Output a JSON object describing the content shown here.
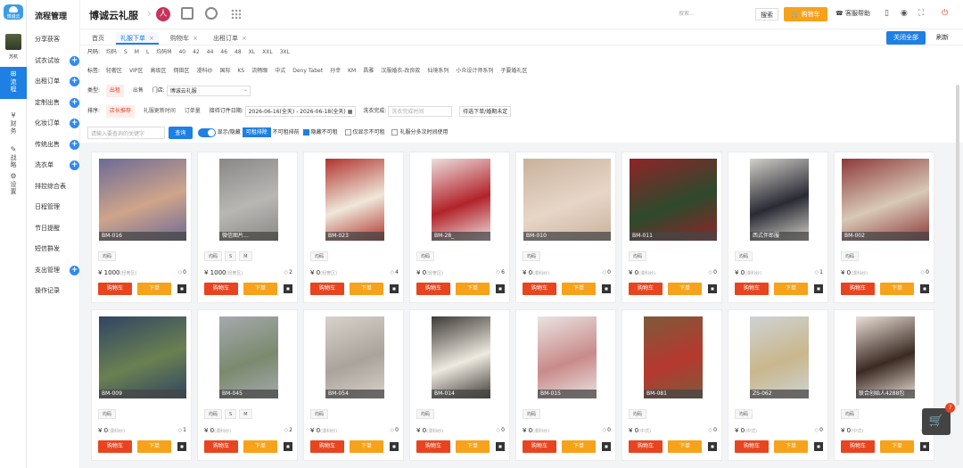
{
  "rail": {
    "logo": "博诚云",
    "user": "苏杭",
    "items": [
      {
        "icon": "⊞",
        "label": "流程",
        "active": true
      },
      {
        "icon": "¥",
        "label": "财务"
      },
      {
        "icon": "✎",
        "label": "战略"
      },
      {
        "icon": "⚙",
        "label": "设置"
      }
    ]
  },
  "submenu": {
    "title": "流程管理",
    "items": [
      {
        "label": "分享获客",
        "plus": false
      },
      {
        "label": "试衣试妆",
        "plus": true
      },
      {
        "label": "出租订单",
        "plus": true
      },
      {
        "label": "定制出售",
        "plus": true
      },
      {
        "label": "化妆订单",
        "plus": true
      },
      {
        "label": "传统出售",
        "plus": true
      },
      {
        "label": "洗衣单",
        "plus": true
      },
      {
        "label": "排控综合表",
        "plus": false
      },
      {
        "label": "日程管理",
        "plus": false
      },
      {
        "label": "节日提醒",
        "plus": false
      },
      {
        "label": "短信群发",
        "plus": false
      },
      {
        "label": "支出管理",
        "plus": true
      },
      {
        "label": "操作记录",
        "plus": false
      }
    ]
  },
  "header": {
    "brand": "博诚云礼服",
    "search_placeholder": "搜索...",
    "search_btn": "搜索",
    "cart_btn": "购物车",
    "help": "客服帮助"
  },
  "tabs": {
    "items": [
      {
        "label": "首页",
        "closable": false,
        "active": false
      },
      {
        "label": "礼服下单",
        "closable": true,
        "active": true
      },
      {
        "label": "购物车",
        "closable": true,
        "active": false
      },
      {
        "label": "出租订单",
        "closable": true,
        "active": false
      }
    ],
    "close_all": "关闭全部",
    "refresh": "刷新"
  },
  "filters": {
    "size": {
      "label": "尺码:",
      "options": [
        "均码",
        "S",
        "M",
        "L",
        "均码M",
        "40",
        "42",
        "44",
        "46",
        "48",
        "XL",
        "XXL",
        "3XL"
      ]
    },
    "tag": {
      "label": "标签:",
      "options": [
        "轻奢区",
        "VIP区",
        "高级区",
        "佣田区",
        "漫科纱",
        "国际",
        "KS",
        "流畅眼",
        "中式",
        "Deny Tabet",
        "孙幸",
        "KM",
        "昌雅",
        "汉服婚衣-改良款",
        "仙境系列",
        "小众设计师系列",
        "子要婚礼区"
      ]
    },
    "type": {
      "label": "类型:",
      "options": [
        "出租",
        "出售"
      ],
      "store_label": "门店:",
      "store_value": "博诚云礼服"
    },
    "sort": {
      "label": "排序:",
      "options": [
        "店长推荐",
        "礼服更新时间",
        "订单量"
      ],
      "date_label": "接待订件日期:",
      "date_value": "2026-06-16(全天) - 2026-06-18(全天)",
      "wash_label": "洗衣完成:",
      "wash_placeholder": "洗衣完成时间",
      "pending": "待选下单/婚期未定"
    },
    "keyword_placeholder": "请输入要查询的关键字",
    "query_btn": "查询",
    "show_hide": "显示/隐藏",
    "available": "可租排除",
    "unavailable": "不可租排前",
    "hide_unavailable": "隐藏不可租",
    "only_unavailable": "仅显示不可租",
    "multi_time": "礼服分多次时间使用"
  },
  "products": [
    {
      "code": "BM-016",
      "sizes": [
        "均码"
      ],
      "price": "¥ 1000",
      "note": "(轻奢区)",
      "count": "0",
      "bg": "#6d6a96",
      "accent": "#cfa58a"
    },
    {
      "code": "微信图片...",
      "sizes": [
        "均码",
        "S",
        "M"
      ],
      "price": "¥ 1000",
      "note": "(轻奢区)",
      "count": "2",
      "bg": "#8a8886",
      "accent": "#b9b7b4"
    },
    {
      "code": "BM-023",
      "sizes": [
        "均码"
      ],
      "price": "¥ 0",
      "note": "(轻奢区)",
      "count": "4",
      "bg": "#b0342e",
      "accent": "#efe8da"
    },
    {
      "code": "BM-28_",
      "sizes": [
        "均码"
      ],
      "price": "¥ 0",
      "note": "(轻奢区)",
      "count": "6",
      "bg": "#ecdede",
      "accent": "#b2232a"
    },
    {
      "code": "BM-010",
      "sizes": [
        "均码"
      ],
      "price": "¥ 0",
      "note": "(漫科纱)",
      "count": "0",
      "bg": "#c9b29c",
      "accent": "#e7d6c7"
    },
    {
      "code": "BM-011",
      "sizes": [
        "均码"
      ],
      "price": "¥ 0",
      "note": "(漫科纱)",
      "count": "0",
      "bg": "#8f2428",
      "accent": "#2d4a2c"
    },
    {
      "code": "西式伴郎服",
      "sizes": [
        "均码"
      ],
      "price": "¥ 0",
      "note": "(漫科纱)",
      "count": "1",
      "bg": "#d2d0c8",
      "accent": "#2a2a35"
    },
    {
      "code": "BM-002",
      "sizes": [
        "均码"
      ],
      "price": "¥ 0",
      "note": "(漫科纱)",
      "count": "0",
      "bg": "#8d3a3a",
      "accent": "#d8c9b7"
    },
    {
      "code": "BM-009",
      "sizes": [
        "均码"
      ],
      "price": "¥ 0",
      "note": "(漫科纱)",
      "count": "1",
      "bg": "#2f4563",
      "accent": "#6b8050"
    },
    {
      "code": "BM-045",
      "sizes": [
        "均码",
        "S",
        "M"
      ],
      "price": "¥ 0",
      "note": "(漫科纱)",
      "count": "2",
      "bg": "#a5a9ad",
      "accent": "#7a8a6e"
    },
    {
      "code": "BM-054",
      "sizes": [
        "均码"
      ],
      "price": "¥ 0",
      "note": "(漫科纱)",
      "count": "0",
      "bg": "#d8d2cb",
      "accent": "#a9a39b"
    },
    {
      "code": "BM-014",
      "sizes": [
        "均码"
      ],
      "price": "¥ 0",
      "note": "(漫科纱)",
      "count": "0",
      "bg": "#3d3935",
      "accent": "#eeeae0"
    },
    {
      "code": "BM-015",
      "sizes": [
        "均码"
      ],
      "price": "¥ 0",
      "note": "(漫科纱)",
      "count": "0",
      "bg": "#e9e4e1",
      "accent": "#c98a8a"
    },
    {
      "code": "BM-081",
      "sizes": [
        "均码"
      ],
      "price": "¥ 0",
      "note": "(中式)",
      "count": "0",
      "bg": "#7d5a3c",
      "accent": "#b6382e"
    },
    {
      "code": "ZS-062",
      "sizes": [
        "均码"
      ],
      "price": "¥ 0",
      "note": "(中式)",
      "count": "0",
      "bg": "#cfd2d4",
      "accent": "#c9b78c"
    },
    {
      "code": "联合创始人4288包",
      "sizes": [
        "均码"
      ],
      "price": "¥ 0",
      "note": "(中式)",
      "count": "0",
      "bg": "#eadfd6",
      "accent": "#3a2a22"
    }
  ],
  "card_labels": {
    "cart": "购物车",
    "order": "下单"
  },
  "float_cart": {
    "badge": "7"
  }
}
